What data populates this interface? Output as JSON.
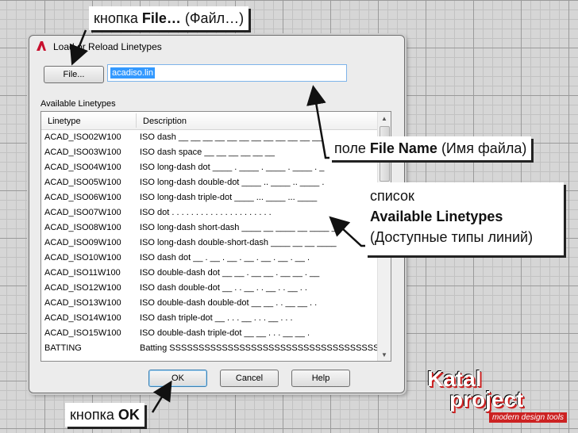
{
  "dialog": {
    "title": "Load or Reload Linetypes",
    "file_button": "File...",
    "file_name_value": "acadiso.lin",
    "available_label": "Available Linetypes",
    "columns": {
      "linetype": "Linetype",
      "description": "Description"
    },
    "rows": [
      {
        "linetype": "ACAD_ISO02W100",
        "description": "ISO dash __ __ __ __ __ __ __ __ __ __ __ __"
      },
      {
        "linetype": "ACAD_ISO03W100",
        "description": "ISO dash space __    __    __    __    __    __"
      },
      {
        "linetype": "ACAD_ISO04W100",
        "description": "ISO long-dash dot ____ . ____ . ____ . ____ . _"
      },
      {
        "linetype": "ACAD_ISO05W100",
        "description": "ISO long-dash double-dot ____ .. ____ .. ____ ."
      },
      {
        "linetype": "ACAD_ISO06W100",
        "description": "ISO long-dash triple-dot ____ ... ____ ... ____"
      },
      {
        "linetype": "ACAD_ISO07W100",
        "description": "ISO dot . . . . . . . . . . . . . . . . . . . . ."
      },
      {
        "linetype": "ACAD_ISO08W100",
        "description": "ISO long-dash short-dash ____ __ ____ __ ____ _"
      },
      {
        "linetype": "ACAD_ISO09W100",
        "description": "ISO long-dash double-short-dash ____ __ __ ____"
      },
      {
        "linetype": "ACAD_ISO10W100",
        "description": "ISO dash dot __ . __ . __ . __ . __ . __ . __ ."
      },
      {
        "linetype": "ACAD_ISO11W100",
        "description": "ISO double-dash dot __ __ . __ __ . __ __ . __"
      },
      {
        "linetype": "ACAD_ISO12W100",
        "description": "ISO dash double-dot __ . . __ . . __ . . __ . ."
      },
      {
        "linetype": "ACAD_ISO13W100",
        "description": "ISO double-dash double-dot __ __ . . __ __ . ."
      },
      {
        "linetype": "ACAD_ISO14W100",
        "description": "ISO dash triple-dot __ . . . __ . . . __ . . ."
      },
      {
        "linetype": "ACAD_ISO15W100",
        "description": "ISO double-dash triple-dot __ __ . . . __ __ ."
      },
      {
        "linetype": "BATTING",
        "description": "Batting SSSSSSSSSSSSSSSSSSSSSSSSSSSSSSSSSSSSSSS"
      }
    ],
    "buttons": {
      "ok": "OK",
      "cancel": "Cancel",
      "help": "Help"
    }
  },
  "callouts": {
    "file_button": {
      "prefix": "кнопка ",
      "bold": "File…",
      "suffix": " (Файл…)"
    },
    "file_name": {
      "prefix": "поле ",
      "bold": "File Name",
      "suffix": " (Имя файла)"
    },
    "list": {
      "line1": "список",
      "line2": "Available Linetypes",
      "line3": "(Доступные типы линий)"
    },
    "ok": {
      "prefix": "кнопка ",
      "bold": "OK",
      "suffix": ""
    }
  },
  "logo": {
    "line1": "Katal",
    "line2": "project",
    "tagline": "modern design tools"
  },
  "colors": {
    "accent": "#3399ff",
    "autocad_red": "#c8102e",
    "logo_red": "#c22222"
  }
}
